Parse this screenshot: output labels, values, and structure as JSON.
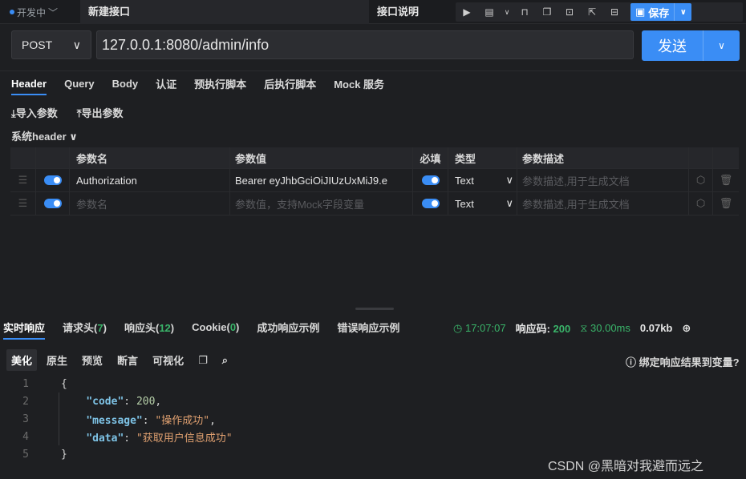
{
  "topbar": {
    "status": "开发中",
    "name": "新建接口",
    "doc": "接口说明",
    "save_label": "保存"
  },
  "request": {
    "method": "POST",
    "url": "127.0.0.1:8080/admin/info",
    "send_label": "发送"
  },
  "tabs": [
    "Header",
    "Query",
    "Body",
    "认证",
    "预执行脚本",
    "后执行脚本",
    "Mock 服务"
  ],
  "actions": {
    "import": "导入参数",
    "export": "导出参数",
    "system_header": "系统header"
  },
  "table": {
    "headers": [
      "参数名",
      "参数值",
      "必填",
      "类型",
      "参数描述"
    ],
    "rows": [
      {
        "name": "Authorization",
        "value": "Bearer eyJhbGciOiJIUzUxMiJ9.e",
        "type": "Text",
        "desc_placeholder": "参数描述,用于生成文档"
      }
    ],
    "new_row": {
      "name_placeholder": "参数名",
      "value_placeholder": "参数值，支持Mock字段变量",
      "type": "Text",
      "desc_placeholder": "参数描述,用于生成文档"
    }
  },
  "response": {
    "tabs": {
      "realtime": "实时响应",
      "req_headers": "请求头",
      "req_headers_count": "7",
      "resp_headers": "响应头",
      "resp_headers_count": "12",
      "cookie": "Cookie",
      "cookie_count": "0",
      "success_example": "成功响应示例",
      "error_example": "错误响应示例"
    },
    "meta": {
      "time": "17:07:07",
      "code_label": "响应码:",
      "code": "200",
      "duration": "30.00ms",
      "size": "0.07kb"
    },
    "view_tabs": [
      "美化",
      "原生",
      "预览",
      "断言",
      "可视化"
    ],
    "bind_label": "绑定响应结果到变量?",
    "code_lines": [
      "1",
      "2",
      "3",
      "4",
      "5"
    ],
    "json": {
      "code_key": "\"code\"",
      "code_val": "200",
      "message_key": "\"message\"",
      "message_val": "\"操作成功\"",
      "data_key": "\"data\"",
      "data_val": "\"获取用户信息成功\""
    }
  },
  "watermark": "CSDN @黑暗对我避而远之"
}
